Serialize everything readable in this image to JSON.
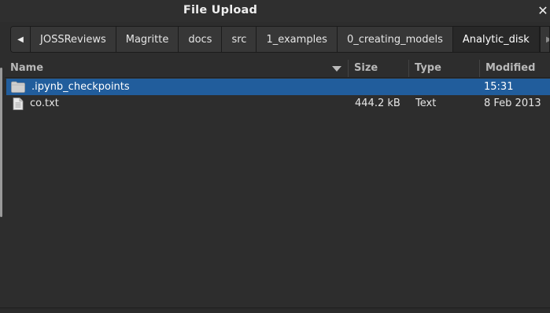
{
  "window": {
    "title": "File Upload",
    "close_glyph": "✕"
  },
  "pathbar": {
    "left_arrow": "◀",
    "right_arrow": "▶",
    "crumbs": [
      {
        "label": "JOSSReviews"
      },
      {
        "label": "Magritte"
      },
      {
        "label": "docs"
      },
      {
        "label": "src"
      },
      {
        "label": "1_examples"
      },
      {
        "label": "0_creating_models"
      },
      {
        "label": "Analytic_disk"
      }
    ],
    "active_index": 6
  },
  "columns": {
    "name": "Name",
    "size": "Size",
    "type": "Type",
    "modified": "Modified"
  },
  "files": [
    {
      "name": ".ipynb_checkpoints",
      "icon": "folder-icon",
      "size": "",
      "type": "",
      "modified": "15:31",
      "selected": true
    },
    {
      "name": "co.txt",
      "icon": "text-file-icon",
      "size": "444.2  kB",
      "type": "Text",
      "modified": "8 Feb 2013",
      "selected": false
    }
  ],
  "colors": {
    "selection": "#215d9c",
    "background": "#2d2d2d"
  }
}
